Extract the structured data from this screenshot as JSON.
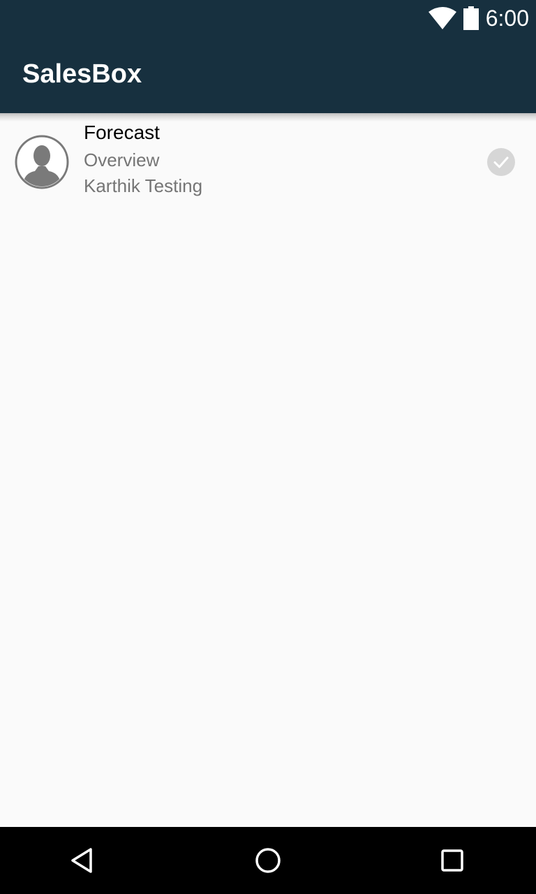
{
  "status_bar": {
    "time": "6:00",
    "icons": [
      "wifi-icon",
      "battery-icon"
    ]
  },
  "app_bar": {
    "title": "SalesBox"
  },
  "list": {
    "items": [
      {
        "title": "Forecast",
        "subtitle": "Overview",
        "owner": "Karthik Testing",
        "avatar_icon": "person-avatar-icon",
        "status_icon": "check-circle-icon"
      }
    ]
  },
  "nav_bar": {
    "buttons": [
      "back-icon",
      "home-icon",
      "recents-icon"
    ]
  },
  "colors": {
    "app_bar": "#17303f",
    "background": "#fafafa",
    "nav_bar": "#000000",
    "secondary_text": "#757575",
    "check_badge": "#d6d6d6"
  }
}
